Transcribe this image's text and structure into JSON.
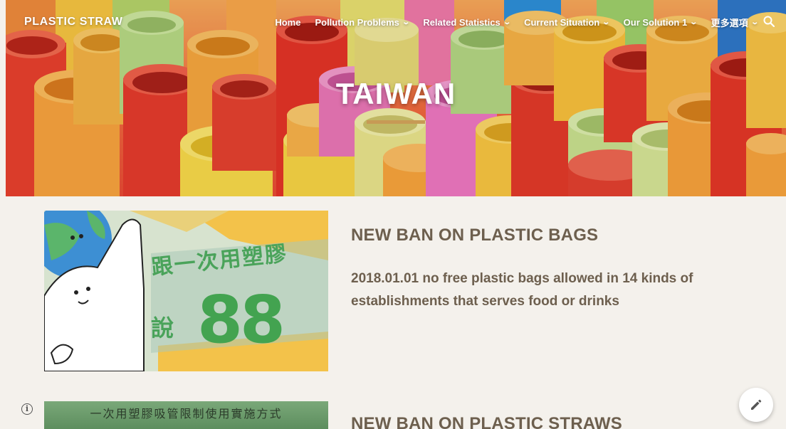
{
  "site": {
    "title": "PLASTIC STRAW"
  },
  "nav": {
    "items": [
      {
        "label": "Home",
        "has_dropdown": false
      },
      {
        "label": "Pollution Problems",
        "has_dropdown": true
      },
      {
        "label": "Related Statistics",
        "has_dropdown": true
      },
      {
        "label": "Current Situation",
        "has_dropdown": true
      },
      {
        "label": "Our Solution 1",
        "has_dropdown": true
      },
      {
        "label": "更多選項",
        "has_dropdown": true
      }
    ],
    "chevron": "⌄",
    "search_icon": "search-icon"
  },
  "hero": {
    "title": "TAIWAN"
  },
  "sections": [
    {
      "heading": "NEW BAN ON PLASTIC BAGS",
      "body": "2018.01.01 no free plastic bags allowed in 14 kinds of establishments that serves food or drinks",
      "image_text_line1": "跟一次用塑膠",
      "image_text_line2": "說",
      "image_text_big": "88"
    },
    {
      "heading": "NEW BAN ON PLASTIC STRAWS",
      "image_caption": "一次用塑膠吸管限制使用實施方式"
    }
  ],
  "ui": {
    "info_icon": "info-icon",
    "edit_icon": "pencil-icon"
  },
  "colors": {
    "accent": "#c79a55",
    "text": "#6d5f4e",
    "background": "#f4f1ec"
  }
}
